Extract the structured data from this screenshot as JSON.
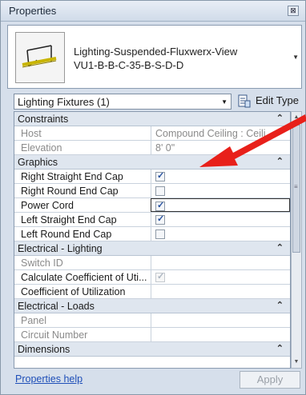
{
  "window": {
    "title": "Properties",
    "close_glyph": "⊠"
  },
  "type_selector": {
    "name_line1": "Lighting-Suspended-Fluxwerx-View",
    "name_line2": "VU1-B-B-C-35-B-S-D-D",
    "thumbnail_icon": "lighting-fixture-icon"
  },
  "category_filter": {
    "value": "Lighting Fixtures (1)"
  },
  "edit_type": {
    "label": "Edit Type",
    "icon": "edit-type-icon"
  },
  "groups": {
    "constraints": "Constraints",
    "graphics": "Graphics",
    "electrical_lighting": "Electrical - Lighting",
    "electrical_loads": "Electrical - Loads",
    "dimensions": "Dimensions"
  },
  "params": {
    "host": {
      "name": "Host",
      "value": "Compound Ceiling : Ceili"
    },
    "elevation": {
      "name": "Elevation",
      "value": "8'  0\""
    },
    "right_straight_end_cap": {
      "name": "Right Straight End Cap",
      "checked": true
    },
    "right_round_end_cap": {
      "name": "Right Round End Cap",
      "checked": false
    },
    "power_cord": {
      "name": "Power Cord",
      "checked": true
    },
    "left_straight_end_cap": {
      "name": "Left Straight End Cap",
      "checked": true
    },
    "left_round_end_cap": {
      "name": "Left Round End Cap",
      "checked": false
    },
    "switch_id": {
      "name": "Switch ID",
      "value": ""
    },
    "calc_coeff": {
      "name": "Calculate Coefficient of Uti...",
      "checked": true
    },
    "coeff_util": {
      "name": "Coefficient of Utilization",
      "value": ""
    },
    "panel": {
      "name": "Panel",
      "value": ""
    },
    "circuit_number": {
      "name": "Circuit Number",
      "value": ""
    }
  },
  "footer": {
    "help_label": "Properties help",
    "apply_label": "Apply"
  },
  "colors": {
    "annotation_arrow": "#e8201a",
    "link": "#1f4fb8"
  }
}
